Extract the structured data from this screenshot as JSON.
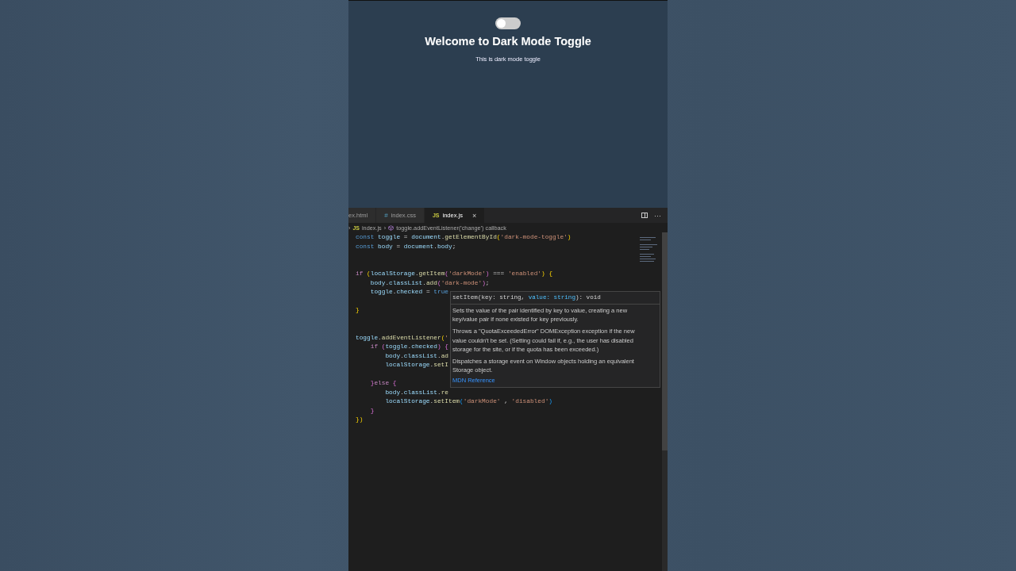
{
  "preview": {
    "toggle": {
      "on": false
    },
    "title": "Welcome to Dark Mode Toggle",
    "text": "This is dark mode toggle"
  },
  "editor": {
    "tabs": [
      {
        "label": "ex.html",
        "selected": false
      },
      {
        "label": "index.css",
        "badge": "#",
        "selected": false
      },
      {
        "label": "index.js",
        "badge": "JS",
        "selected": true,
        "close": "×"
      }
    ],
    "actions": [
      "···"
    ],
    "breadcrumb": {
      "separator_1": "›",
      "badge": "JS",
      "file": "index.js",
      "separator_2": "›",
      "symbol": "toggle.addEventListener('change') callback"
    },
    "lines": [
      {
        "kind": "code",
        "tokens": [
          {
            "kind": "kw",
            "text": "const "
          },
          {
            "kind": "var",
            "text": "toggle"
          },
          {
            "kind": "p",
            "text": " = "
          },
          {
            "kind": "var",
            "text": "document"
          },
          {
            "kind": "p",
            "text": "."
          },
          {
            "kind": "fn",
            "text": "getElementById"
          },
          {
            "kind": "br1",
            "text": "("
          },
          {
            "kind": "str",
            "text": "'dark-mode-toggle'"
          },
          {
            "kind": "br1",
            "text": ")"
          }
        ]
      },
      {
        "kind": "code",
        "tokens": [
          {
            "kind": "kw",
            "text": "const "
          },
          {
            "kind": "var",
            "text": "body"
          },
          {
            "kind": "p",
            "text": " = "
          },
          {
            "kind": "var",
            "text": "document"
          },
          {
            "kind": "p",
            "text": "."
          },
          {
            "kind": "var",
            "text": "body"
          },
          {
            "kind": "p",
            "text": ";"
          }
        ]
      },
      {
        "kind": "blank"
      },
      {
        "kind": "blank"
      },
      {
        "kind": "code",
        "tokens": [
          {
            "kind": "ctl",
            "text": "if "
          },
          {
            "kind": "br1",
            "text": "("
          },
          {
            "kind": "var",
            "text": "localStorage"
          },
          {
            "kind": "p",
            "text": "."
          },
          {
            "kind": "fn",
            "text": "getItem"
          },
          {
            "kind": "br2",
            "text": "("
          },
          {
            "kind": "str",
            "text": "'darkMode'"
          },
          {
            "kind": "br2",
            "text": ")"
          },
          {
            "kind": "p",
            "text": " === "
          },
          {
            "kind": "str",
            "text": "'enabled'"
          },
          {
            "kind": "br1",
            "text": ")"
          },
          {
            "kind": "br1",
            "text": " {"
          }
        ],
        "children": [
          {
            "kind": "code",
            "tokens": [
              {
                "kind": "var",
                "text": "body"
              },
              {
                "kind": "p",
                "text": "."
              },
              {
                "kind": "var",
                "text": "classList"
              },
              {
                "kind": "p",
                "text": "."
              },
              {
                "kind": "fn",
                "text": "add"
              },
              {
                "kind": "br2",
                "text": "("
              },
              {
                "kind": "str",
                "text": "'dark-mode'"
              },
              {
                "kind": "br2",
                "text": ")"
              },
              {
                "kind": "p",
                "text": ";"
              }
            ]
          },
          {
            "kind": "code",
            "tokens": [
              {
                "kind": "var",
                "text": "toggle"
              },
              {
                "kind": "p",
                "text": "."
              },
              {
                "kind": "var",
                "text": "checked"
              },
              {
                "kind": "p",
                "text": " = "
              },
              {
                "kind": "kw",
                "text": "true"
              }
            ]
          },
          {
            "kind": "blank"
          }
        ]
      },
      {
        "kind": "code",
        "tokens": [
          {
            "kind": "br1",
            "text": "}"
          }
        ]
      },
      {
        "kind": "blank"
      },
      {
        "kind": "blank"
      },
      {
        "kind": "code",
        "tokens": [
          {
            "kind": "var",
            "text": "toggle"
          },
          {
            "kind": "p",
            "text": "."
          },
          {
            "kind": "fn",
            "text": "addEventListener"
          },
          {
            "kind": "br1",
            "text": "("
          },
          {
            "kind": "str",
            "text": "'"
          }
        ],
        "children": [
          {
            "kind": "code",
            "tokens": [
              {
                "kind": "ctl",
                "text": "if "
              },
              {
                "kind": "br2",
                "text": "("
              },
              {
                "kind": "var",
                "text": "toggle"
              },
              {
                "kind": "p",
                "text": "."
              },
              {
                "kind": "var",
                "text": "checked"
              },
              {
                "kind": "br2",
                "text": ")"
              },
              {
                "kind": "br2",
                "text": " {"
              }
            ],
            "children": [
              {
                "kind": "code",
                "tokens": [
                  {
                    "kind": "var",
                    "text": "body"
                  },
                  {
                    "kind": "p",
                    "text": "."
                  },
                  {
                    "kind": "var",
                    "text": "classList"
                  },
                  {
                    "kind": "p",
                    "text": "."
                  },
                  {
                    "kind": "fn",
                    "text": "ad"
                  }
                ]
              },
              {
                "kind": "code",
                "tokens": [
                  {
                    "kind": "var",
                    "text": "localStorage"
                  },
                  {
                    "kind": "p",
                    "text": "."
                  },
                  {
                    "kind": "fn",
                    "text": "setI"
                  }
                ]
              },
              {
                "kind": "blank"
              }
            ]
          },
          {
            "kind": "code",
            "tokens": [
              {
                "kind": "br2",
                "text": "}"
              },
              {
                "kind": "ctl",
                "text": "else "
              },
              {
                "kind": "br2",
                "text": "{"
              }
            ],
            "children": [
              {
                "kind": "code",
                "tokens": [
                  {
                    "kind": "var",
                    "text": "body"
                  },
                  {
                    "kind": "p",
                    "text": "."
                  },
                  {
                    "kind": "var",
                    "text": "classList"
                  },
                  {
                    "kind": "p",
                    "text": "."
                  },
                  {
                    "kind": "fn",
                    "text": "re"
                  }
                ]
              },
              {
                "kind": "code",
                "tokens": [
                  {
                    "kind": "var",
                    "text": "localStorage"
                  },
                  {
                    "kind": "p",
                    "text": "."
                  },
                  {
                    "kind": "fn",
                    "text": "setItem"
                  },
                  {
                    "kind": "br3",
                    "text": "("
                  },
                  {
                    "kind": "str",
                    "text": "'darkMode'"
                  },
                  {
                    "kind": "p",
                    "text": " , "
                  },
                  {
                    "kind": "str",
                    "text": "'disabled'"
                  },
                  {
                    "kind": "br3",
                    "text": ")"
                  }
                ]
              }
            ]
          },
          {
            "kind": "code",
            "tokens": [
              {
                "kind": "br2",
                "text": "}"
              }
            ]
          }
        ]
      },
      {
        "kind": "code",
        "tokens": [
          {
            "kind": "br1",
            "text": "}"
          },
          {
            "kind": "br1",
            "text": ")"
          }
        ]
      }
    ],
    "tooltip": {
      "signature": [
        {
          "kind": "p",
          "text": "setItem(key: string, "
        },
        {
          "kind": "param",
          "text": "value: string"
        },
        {
          "kind": "p",
          "text": "): void"
        }
      ],
      "paragraphs": [
        "Sets the value of the pair identified by key to value, creating a new key/value pair if none existed for key previously.",
        "Throws a \"QuotaExceededError\" DOMException exception if the new value couldn't be set. (Setting could fail if, e.g., the user has disabled storage for the site, or if the quota has been exceeded.)",
        "Dispatches a storage event on Window objects holding an equivalent Storage object."
      ],
      "link": "MDN Reference"
    }
  }
}
